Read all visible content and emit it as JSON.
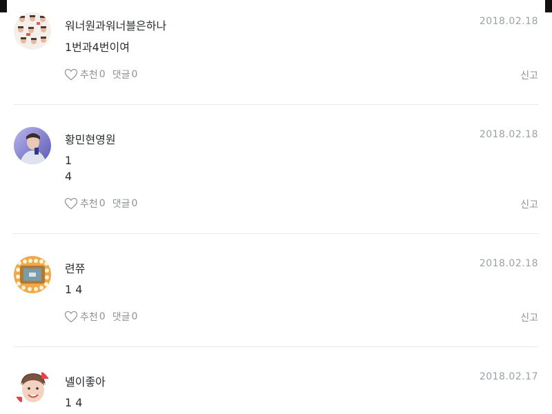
{
  "comments": [
    {
      "nickname": "워너원과워너블은하나",
      "date": "2018.02.18",
      "text": "1번과4번이여",
      "like_label": "추천",
      "like_count": "0",
      "reply_label": "댓글",
      "reply_count": "0",
      "report_label": "신고"
    },
    {
      "nickname": "황민현영원",
      "date": "2018.02.18",
      "text": "1\n4",
      "like_label": "추천",
      "like_count": "0",
      "reply_label": "댓글",
      "reply_count": "0",
      "report_label": "신고"
    },
    {
      "nickname": "련쮸",
      "date": "2018.02.18",
      "text": "1 4",
      "like_label": "추천",
      "like_count": "0",
      "reply_label": "댓글",
      "reply_count": "0",
      "report_label": "신고"
    },
    {
      "nickname": "녤이좋아",
      "date": "2018.02.17",
      "text": "1 4"
    }
  ],
  "colors": {
    "text": "#2b2e31",
    "muted": "#8d9297",
    "date": "#9aa0a6",
    "divider": "#e6e8ea"
  },
  "icons": {
    "like": "heart-outline-icon"
  }
}
